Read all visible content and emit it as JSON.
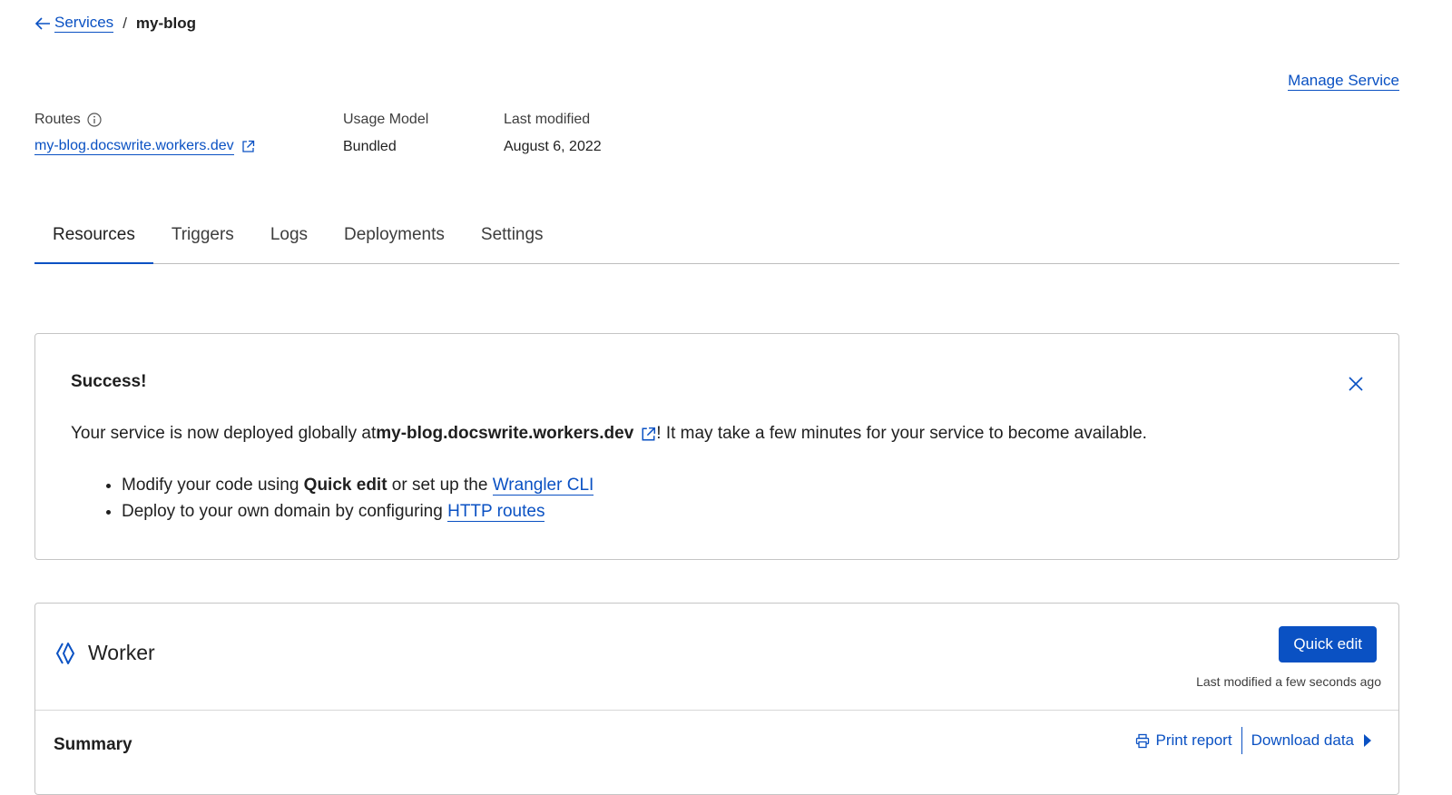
{
  "breadcrumb": {
    "parent": "Services",
    "current": "my-blog"
  },
  "header": {
    "manage_service": "Manage Service"
  },
  "meta": {
    "routes_label": "Routes",
    "route_value": "my-blog.docswrite.workers.dev",
    "usage_label": "Usage Model",
    "usage_value": "Bundled",
    "modified_label": "Last modified",
    "modified_value": "August 6, 2022"
  },
  "tabs": [
    "Resources",
    "Triggers",
    "Logs",
    "Deployments",
    "Settings"
  ],
  "success": {
    "title": "Success!",
    "text_before": "Your service is now deployed globally at ",
    "domain": "my-blog.docswrite.workers.dev",
    "text_after": "! It may take a few minutes for your service to become available.",
    "bullet1_before": "Modify your code using ",
    "bullet1_bold": "Quick edit",
    "bullet1_mid": " or set up the ",
    "bullet1_link": "Wrangler CLI",
    "bullet2_before": "Deploy to your own domain by configuring ",
    "bullet2_link": "HTTP routes"
  },
  "worker": {
    "title": "Worker",
    "quick_edit": "Quick edit",
    "last_modified": "Last modified a few seconds ago",
    "summary": "Summary",
    "print_report": "Print report",
    "download_data": "Download data"
  },
  "colors": {
    "accent": "#0a51c3",
    "border": "#c5c5c5"
  }
}
